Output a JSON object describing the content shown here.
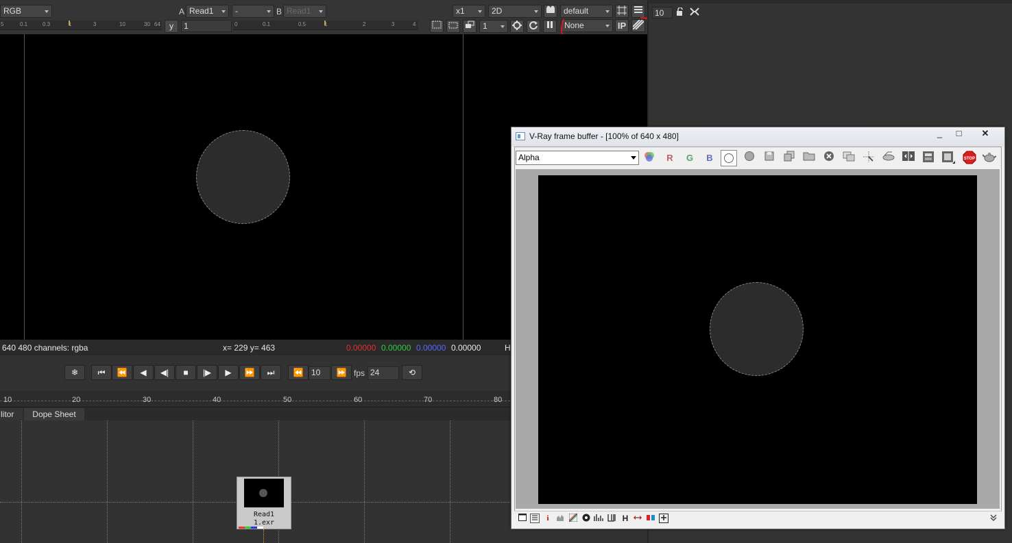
{
  "viewer": {
    "channel_select": "RGB",
    "a_label": "A",
    "a_input": "Read1",
    "operation": "-",
    "b_label": "B",
    "b_input": "Read1",
    "zoom": "x1",
    "view_mode": "2D",
    "lut": "default",
    "y_label": "y",
    "y_value": "1",
    "proxy_value": "1",
    "roi_select": "None",
    "ip_label": "IP",
    "gain_ticks": [
      "5",
      "0.1",
      "0.3",
      "1",
      "3",
      "10",
      "30",
      "64"
    ],
    "gamma_ticks": [
      "0",
      "0.1",
      "0.5",
      "1",
      "2",
      "3",
      "4"
    ],
    "info_format": "640 480  channels: rgba",
    "info_coords": "x= 229 y= 463",
    "info_r": "0.00000",
    "info_g": "0.00000",
    "info_b": "0.00000",
    "info_a": "0.00000",
    "info_h": "H",
    "colors": {
      "r": "#e03030",
      "g": "#2ecc40",
      "b": "#4a5dff",
      "a": "#e8e8e8",
      "annotation": "#e0161a"
    }
  },
  "properties": {
    "max_panels": "10"
  },
  "playback": {
    "frame": "10",
    "fps_label": "fps",
    "fps": "24",
    "timeline_ticks": [
      "10",
      "20",
      "30",
      "40",
      "50",
      "60",
      "70",
      "80"
    ]
  },
  "tabs": {
    "node_graph_partial": "litor",
    "dope_sheet": "Dope Sheet"
  },
  "node": {
    "name": "Read1",
    "file": "1.exr"
  },
  "vray": {
    "title": "V-Ray frame buffer - [100% of 640 x 480]",
    "channel": "Alpha",
    "r_label": "R",
    "g_label": "G",
    "b_label": "B",
    "stop_label": "STOP",
    "h_label": "H",
    "i_label": "i"
  }
}
